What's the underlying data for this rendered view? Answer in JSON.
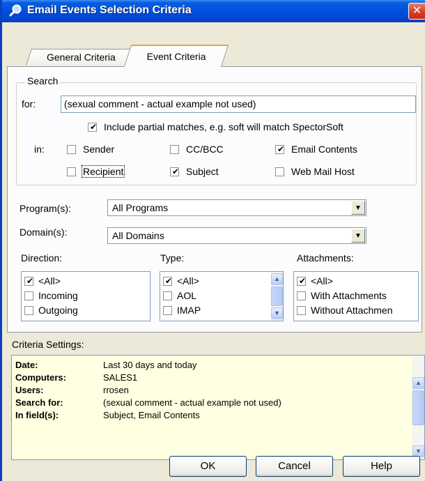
{
  "window": {
    "title": "Email Events Selection Criteria",
    "close_glyph": "✕"
  },
  "tabs": [
    {
      "label": "General Criteria",
      "selected": false
    },
    {
      "label": "Event Criteria",
      "selected": true
    }
  ],
  "search": {
    "group_label": "Search",
    "for_label": "for:",
    "for_value": "(sexual comment - actual example not used)",
    "partial_label": "Include partial matches, e.g. soft will match SpectorSoft",
    "partial_checked": true,
    "in_label": "in:",
    "fields": [
      {
        "label": "Sender",
        "checked": false
      },
      {
        "label": "CC/BCC",
        "checked": false
      },
      {
        "label": "Email Contents",
        "checked": true
      },
      {
        "label": "Recipient",
        "checked": false
      },
      {
        "label": "Subject",
        "checked": true
      },
      {
        "label": "Web Mail Host",
        "checked": false
      }
    ]
  },
  "program": {
    "label": "Program(s):",
    "value": "All Programs"
  },
  "domain": {
    "label": "Domain(s):",
    "value": "All Domains"
  },
  "direction": {
    "label": "Direction:",
    "items": [
      {
        "label": "<All>",
        "checked": true
      },
      {
        "label": "Incoming",
        "checked": false
      },
      {
        "label": "Outgoing",
        "checked": false
      }
    ]
  },
  "type": {
    "label": "Type:",
    "items": [
      {
        "label": "<All>",
        "checked": true
      },
      {
        "label": "AOL",
        "checked": false
      },
      {
        "label": "IMAP",
        "checked": false
      }
    ]
  },
  "attachments": {
    "label": "Attachments:",
    "items": [
      {
        "label": "<All>",
        "checked": true
      },
      {
        "label": "With Attachments",
        "checked": false
      },
      {
        "label": "Without Attachmen",
        "checked": false
      }
    ]
  },
  "criteria_settings": {
    "label": "Criteria Settings:",
    "rows": [
      {
        "key": "Date:",
        "value": "Last 30 days and today"
      },
      {
        "key": "Computers:",
        "value": "SALES1"
      },
      {
        "key": "Users:",
        "value": "rrosen"
      },
      {
        "key": "Search for:",
        "value": "(sexual comment - actual example not used)"
      },
      {
        "key": "In field(s):",
        "value": "Subject, Email Contents"
      }
    ]
  },
  "buttons": {
    "ok": "OK",
    "cancel": "Cancel",
    "help": "Help"
  },
  "icons": {
    "title": "search-magnifier-icon",
    "check": "✔",
    "combo_arrow": "▼",
    "scroll_up": "▲",
    "scroll_down": "▼"
  },
  "colors": {
    "titlebar": "#0a5ddc",
    "settings_bg": "#ffffe1",
    "tab_highlight": "#f5a42c"
  }
}
